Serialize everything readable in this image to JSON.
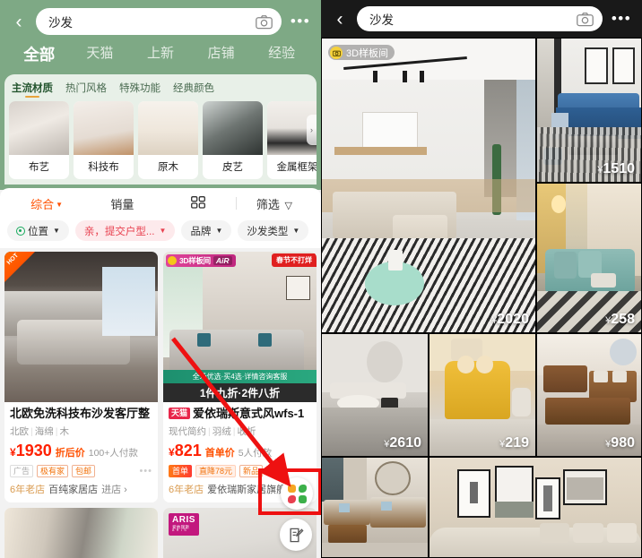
{
  "left": {
    "header": {
      "back_icon": "chevron-left-icon",
      "search_value": "沙发",
      "camera_icon": "camera-icon",
      "more_icon": "more-dots-icon",
      "bg_color": "#7ea985"
    },
    "tabs": [
      {
        "label": "全部",
        "active": true
      },
      {
        "label": "天猫",
        "active": false
      },
      {
        "label": "上新",
        "active": false
      },
      {
        "label": "店铺",
        "active": false
      },
      {
        "label": "经验",
        "active": false
      }
    ],
    "category_tabs": [
      {
        "label": "主流材质",
        "active": true
      },
      {
        "label": "热门风格",
        "active": false
      },
      {
        "label": "特殊功能",
        "active": false
      },
      {
        "label": "经典颜色",
        "active": false
      }
    ],
    "category_items": [
      {
        "label": "布艺"
      },
      {
        "label": "科技布"
      },
      {
        "label": "原木"
      },
      {
        "label": "皮艺"
      },
      {
        "label": "金属框架"
      }
    ],
    "sort_bar": [
      {
        "label": "综合",
        "caret": true,
        "active": true
      },
      {
        "label": "销量",
        "caret": false,
        "active": false
      },
      {
        "label": "grid-view-icon",
        "icon": true,
        "active": false
      },
      {
        "label": "筛选",
        "funnel": true,
        "active": false
      }
    ],
    "filter_chips": [
      {
        "label": "位置",
        "pin": true,
        "caret": true,
        "highlight": false
      },
      {
        "label": "亲，提交户型...",
        "pin": false,
        "caret": true,
        "highlight": true
      },
      {
        "label": "品牌",
        "pin": false,
        "caret": true,
        "highlight": false
      },
      {
        "label": "沙发类型",
        "pin": false,
        "caret": true,
        "highlight": false
      }
    ],
    "products": [
      {
        "corner_badge": "HOT",
        "title": "北欧免洗科技布沙发客厅整",
        "attrs": [
          "北欧",
          "海绵",
          "木"
        ],
        "price": "1930",
        "price_label": "折后价",
        "sold": "100+人付款",
        "tags": [
          {
            "text": "广告",
            "style": "grey"
          },
          {
            "text": "极有家",
            "style": "outline"
          },
          {
            "text": "包邮",
            "style": "outline"
          }
        ],
        "overflow_icon": "more-dots-icon",
        "shop_years": "6年老店",
        "shop_name": "百纯家居店",
        "shop_enter": "进店 ›"
      },
      {
        "badge_3d": "3D样板间",
        "badge_air": "AiR",
        "ribbon": "春节不打烊",
        "promo_green": "全场优选·买4选·详情咨询客服",
        "promo_dark": "1件九折·2件八折",
        "tmall_tag": "天猫",
        "title": "爱依瑞斯意式风wfs-1",
        "attrs": [
          "现代简约",
          "羽绒",
          "收折"
        ],
        "price": "821",
        "price_label": "首单价",
        "sold": "5人付款",
        "tags": [
          {
            "text": "首单",
            "style": "solid"
          },
          {
            "text": "直降78元",
            "style": "pink"
          },
          {
            "text": "新品",
            "style": "outline"
          }
        ],
        "shop_years": "6年老店",
        "shop_name": "爱依瑞斯家居旗舰店",
        "shop_enter": ""
      }
    ],
    "partial_cards": [
      {
        "badge": null
      },
      {
        "badge": {
          "line1": "ARIS",
          "line2": "爱依瑞斯",
          "line3": "A R I S"
        }
      }
    ],
    "fab_assistant": {
      "icon": "pinwheel-assistant-icon"
    },
    "fab_note": {
      "icon": "edit-note-icon"
    },
    "highlight_box_color": "#ee1111",
    "annotation_arrow_color": "#ee1111"
  },
  "right": {
    "header": {
      "back_icon": "chevron-left-icon",
      "search_value": "沙发",
      "camera_icon": "camera-icon",
      "more_icon": "more-dots-icon",
      "bg_color": "#191919"
    },
    "hero_badge": {
      "icon": "camera-3d-icon",
      "label": "3D样板间"
    },
    "tiles": [
      {
        "name": "hero-living-room",
        "price": "2020",
        "yen": "¥",
        "price_visible": true
      },
      {
        "name": "blue-sofa-room",
        "price": "1510",
        "yen": "¥",
        "price_visible": true
      },
      {
        "name": "teal-sofa-room",
        "price": "258",
        "yen": "¥",
        "price_visible": true
      },
      {
        "name": "grey-minimal-room",
        "price": "2610",
        "yen": "¥",
        "price_visible": true
      },
      {
        "name": "yellow-sofa-room",
        "price": "219",
        "yen": "¥",
        "price_visible": true
      },
      {
        "name": "wood-sofa-room",
        "price": "980",
        "yen": "¥",
        "price_visible": true
      },
      {
        "name": "chinese-wood-room",
        "price": "",
        "yen": "",
        "price_visible": false
      },
      {
        "name": "gallery-wall-room",
        "price": "",
        "yen": "",
        "price_visible": false
      }
    ]
  }
}
